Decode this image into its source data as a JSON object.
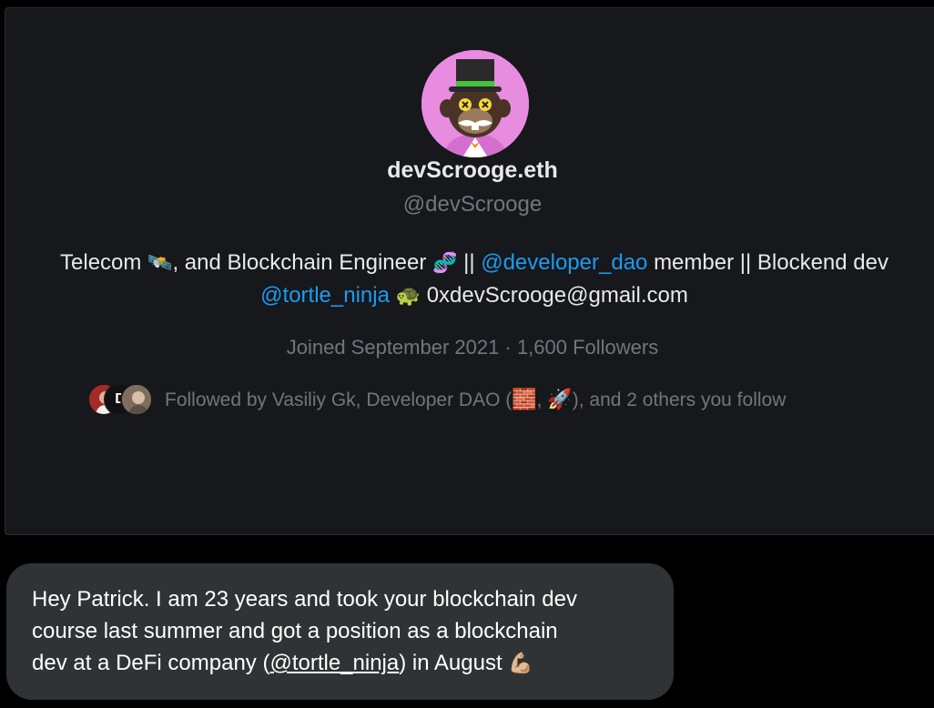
{
  "profile": {
    "display_name": "devScrooge.eth",
    "handle": "@devScrooge",
    "bio": {
      "part1": "Telecom",
      "emoji_satellite": "🛰️",
      "part2": ", and Blockchain Engineer",
      "emoji_dna": "🧬",
      "part3": "||",
      "mention1": "@developer_dao",
      "part4": "member || Blockend dev",
      "mention2": "@tortle_ninja",
      "emoji_turtle": "🐢",
      "email": "0xdevScrooge@gmail.com"
    },
    "joined": "Joined September 2021",
    "separator": "·",
    "followers": "1,600 Followers",
    "followed_by": {
      "prefix": "Followed by Vasiliy Gk, Developer DAO (",
      "emoji_brick": "🧱",
      "comma": ", ",
      "emoji_rocket": "🚀",
      "suffix": "), and 2 others you follow",
      "mini_avatar_letter": "D"
    }
  },
  "dm": {
    "line1": "Hey Patrick. I am 23 years and took your blockchain dev",
    "line2": "course last summer and got a position as a blockchain",
    "line3_pre": "dev at a DeFi company (",
    "mention": "@tortle_ninja",
    "line3_post": ") in August",
    "emoji_muscle": "💪🏼"
  },
  "colors": {
    "card_background": "#16181c",
    "mention_blue": "#1d9bf0",
    "muted_gray": "#71767b",
    "dm_bubble": "#2f3336",
    "avatar_pink": "#e88ce0"
  }
}
